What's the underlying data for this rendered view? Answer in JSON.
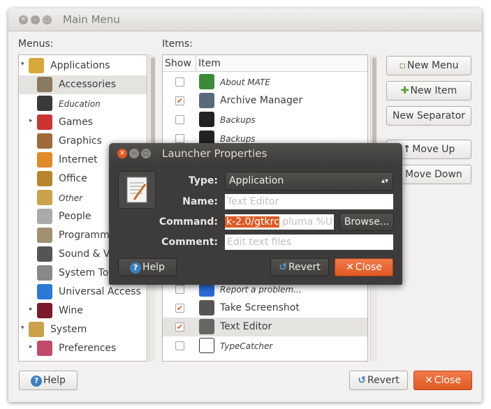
{
  "window": {
    "title": "Main Menu"
  },
  "menus_label": "Menus:",
  "items_label": "Items:",
  "menus": [
    {
      "label": "Applications",
      "icon": "applications-icon",
      "expanded": true,
      "italic": false
    },
    {
      "label": "Accessories",
      "icon": "accessories-icon",
      "selected": true,
      "italic": false
    },
    {
      "label": "Education",
      "icon": "education-icon",
      "italic": true
    },
    {
      "label": "Games",
      "icon": "games-icon",
      "italic": false
    },
    {
      "label": "Graphics",
      "icon": "graphics-icon",
      "italic": false
    },
    {
      "label": "Internet",
      "icon": "internet-icon",
      "italic": false
    },
    {
      "label": "Office",
      "icon": "office-icon",
      "italic": false
    },
    {
      "label": "Other",
      "icon": "other-icon",
      "italic": true
    },
    {
      "label": "People",
      "icon": "people-icon",
      "italic": false
    },
    {
      "label": "Programm",
      "icon": "programming-icon",
      "italic": false
    },
    {
      "label": "Sound & V",
      "icon": "sound-video-icon",
      "italic": false
    },
    {
      "label": "System To",
      "icon": "system-tools-icon",
      "italic": false
    },
    {
      "label": "Universal Access",
      "icon": "universal-access-icon",
      "italic": false
    },
    {
      "label": "Wine",
      "icon": "wine-icon",
      "italic": false
    },
    {
      "label": "System",
      "icon": "system-icon",
      "italic": false
    },
    {
      "label": "Preferences",
      "icon": "preferences-icon",
      "italic": false
    }
  ],
  "items_table": {
    "headers": {
      "show": "Show",
      "item": "Item"
    },
    "rows": [
      {
        "label": "About MATE",
        "checked": false,
        "italic": true
      },
      {
        "label": "Archive Manager",
        "checked": true,
        "italic": false
      },
      {
        "label": "Backups",
        "checked": false,
        "italic": true
      },
      {
        "label": "Backups",
        "checked": false,
        "italic": true
      },
      {
        "label": "Report a problem...",
        "checked": false,
        "italic": true
      },
      {
        "label": "Take Screenshot",
        "checked": true,
        "italic": false
      },
      {
        "label": "Text Editor",
        "checked": true,
        "italic": false,
        "selected": true
      },
      {
        "label": "TypeCatcher",
        "checked": false,
        "italic": true
      }
    ]
  },
  "side_buttons": {
    "new_menu": "New Menu",
    "new_item": "New Item",
    "new_separator": "New Separator",
    "move_up": "Move Up",
    "move_down": "Move Down"
  },
  "bottom_buttons": {
    "help": "Help",
    "revert": "Revert",
    "close": "Close"
  },
  "dialog": {
    "title": "Launcher Properties",
    "type_label": "Type:",
    "type_value": "Application",
    "name_label": "Name:",
    "name_placeholder": "Text Editor",
    "command_label": "Command:",
    "command_selected": "k-2.0/gtkrc",
    "command_rest": " pluma %U",
    "browse": "Browse...",
    "comment_label": "Comment:",
    "comment_placeholder": "Edit text files",
    "help": "Help",
    "revert": "Revert",
    "close": "Close"
  },
  "colors": {
    "accent": "#e05a23",
    "dialog_bg": "#3d3c3a"
  }
}
